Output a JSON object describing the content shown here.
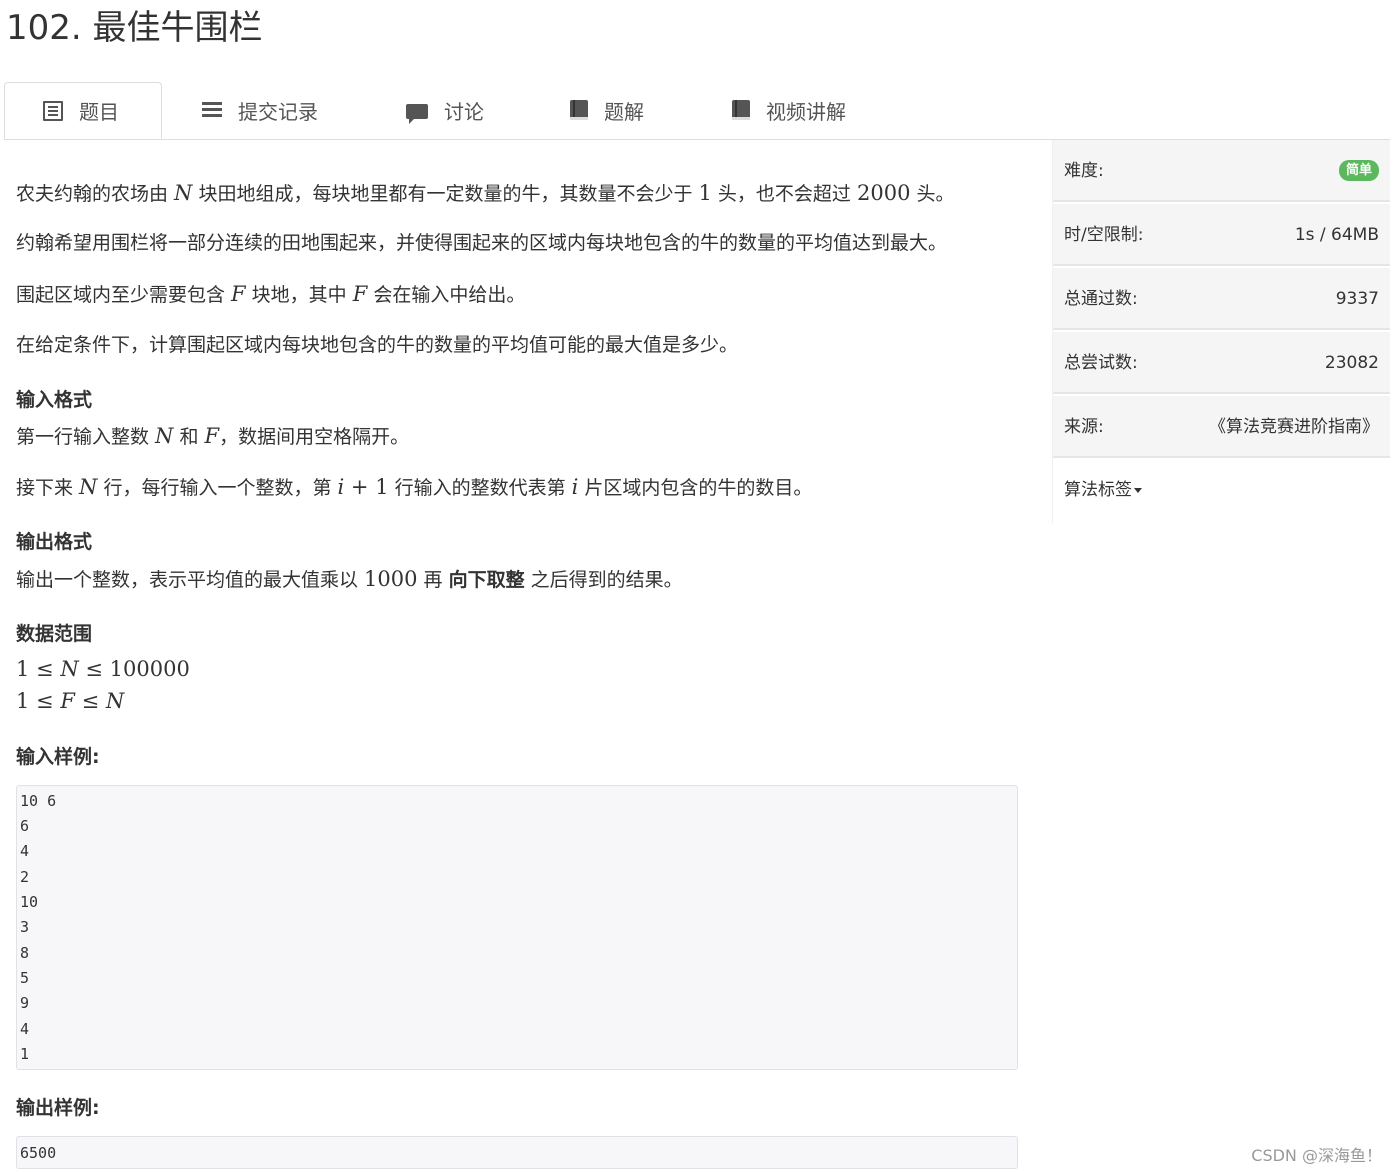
{
  "title": "102. 最佳牛围栏",
  "tabs": [
    {
      "label": "题目",
      "icon": "list-alt-icon"
    },
    {
      "label": "提交记录",
      "icon": "list-icon"
    },
    {
      "label": "讨论",
      "icon": "comment-icon"
    },
    {
      "label": "题解",
      "icon": "book-icon"
    },
    {
      "label": "视频讲解",
      "icon": "book-icon"
    }
  ],
  "problem": {
    "p1": {
      "a": "农夫约翰的农场由 ",
      "N": "N",
      "b": " 块田地组成，每块地里都有一定数量的牛，其数量不会少于 ",
      "n1": "1",
      "c": " 头，也不会超过 ",
      "n2": "2000",
      "d": " 头。"
    },
    "p2": "约翰希望用围栏将一部分连续的田地围起来，并使得围起来的区域内每块地包含的牛的数量的平均值达到最大。",
    "p3": {
      "a": "围起区域内至少需要包含 ",
      "F": "F",
      "b": " 块地，其中 ",
      "F2": "F",
      "c": " 会在输入中给出。"
    },
    "p4": "在给定条件下，计算围起区域内每块地包含的牛的数量的平均值可能的最大值是多少。",
    "input_heading": "输入格式",
    "in1": {
      "a": "第一行输入整数 ",
      "N": "N",
      "b": " 和 ",
      "F": "F",
      "c": "，数据间用空格隔开。"
    },
    "in2": {
      "a": "接下来 ",
      "N": "N",
      "b": " 行，每行输入一个整数，第 ",
      "expr_i": "i",
      "plus": " + ",
      "one": "1",
      "c": " 行输入的整数代表第 ",
      "i": "i",
      "d": " 片区域内包含的牛的数目。"
    },
    "output_heading": "输出格式",
    "out1": {
      "a": "输出一个整数，表示平均值的最大值乘以 ",
      "n": "1000",
      "b": " 再 ",
      "bold": "向下取整",
      "c": " 之后得到的结果。"
    },
    "range_heading": "数据范围",
    "range1": {
      "a": "1",
      "le1": " ≤ ",
      "v": "N",
      "le2": " ≤ ",
      "b": "100000"
    },
    "range2": {
      "a": "1",
      "le1": " ≤ ",
      "v": "F",
      "le2": " ≤ ",
      "b": "N"
    },
    "sample_in_heading": "输入样例:",
    "sample_in": [
      "10 6",
      "6",
      "4",
      "2",
      "10",
      "3",
      "8",
      "5",
      "9",
      "4",
      "1"
    ],
    "sample_out_heading": "输出样例:",
    "sample_out": [
      "6500"
    ]
  },
  "sidebar": {
    "difficulty_label": "难度:",
    "difficulty_badge": "简单",
    "limit_label": "时/空限制:",
    "limit_value": "1s / 64MB",
    "passed_label": "总通过数:",
    "passed_value": "9337",
    "tried_label": "总尝试数:",
    "tried_value": "23082",
    "source_label": "来源:",
    "source_value": "《算法竞赛进阶指南》",
    "tags_label": "算法标签"
  },
  "watermark": "CSDN @深海鱼！",
  "colors": {
    "badge_green": "#5cb85c",
    "code_bg": "#f7f7f9",
    "sidebar_bg": "#f5f5f5"
  }
}
